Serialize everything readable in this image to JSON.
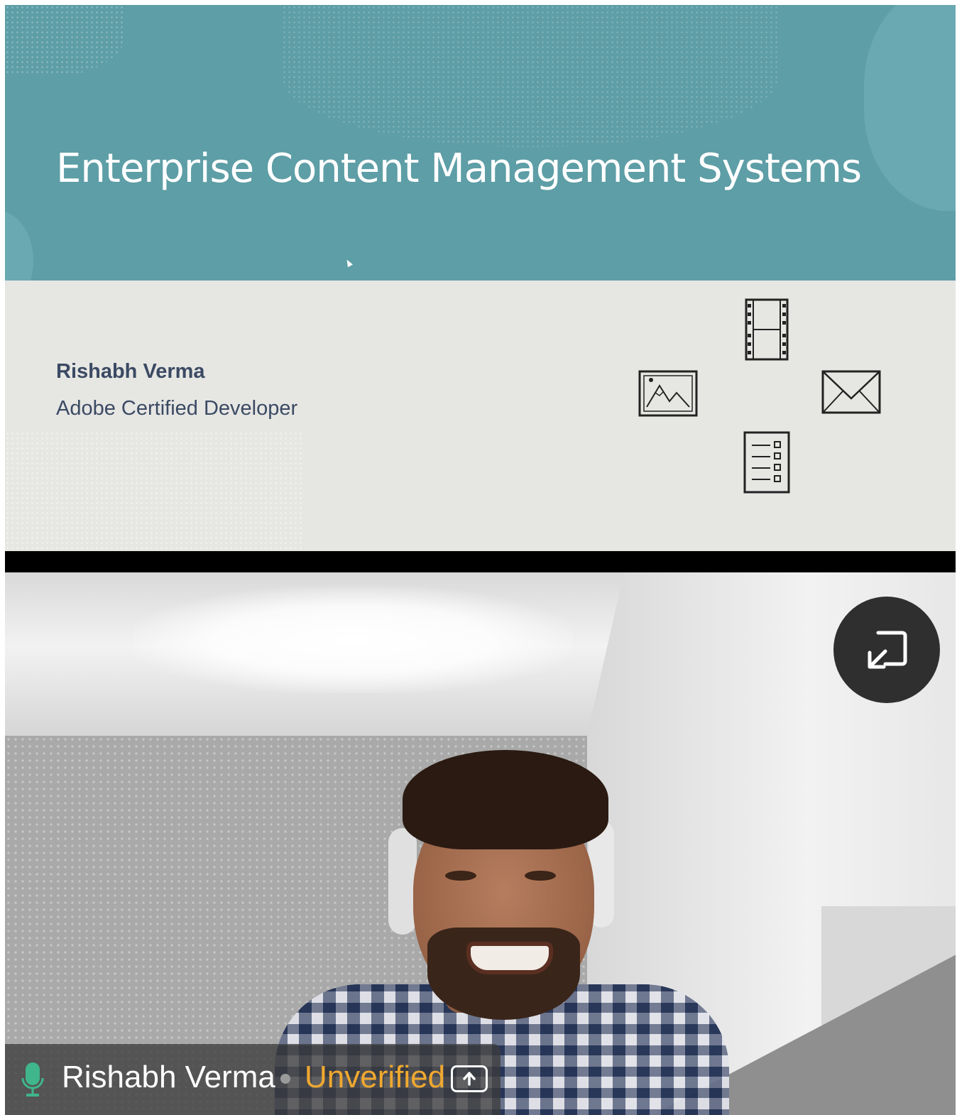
{
  "slide": {
    "title": "Enterprise Content Management Systems",
    "presenter_name": "Rishabh Verma",
    "presenter_role": "Adobe Certified Developer",
    "icons": [
      "film-icon",
      "image-icon",
      "mail-icon",
      "document-list-icon"
    ],
    "colors": {
      "header": "#5e9ea6",
      "body": "#e6e6e3",
      "text": "#3b4a63"
    }
  },
  "video_tile": {
    "participant_name": "Rishabh Verma",
    "status": "Unverified",
    "mic_icon": "microphone-icon",
    "exit_fullscreen_icon": "exit-fullscreen-icon",
    "share_icon": "upload-arrow-icon",
    "colors": {
      "status": "#f0a830",
      "mic": "#3fb68b"
    }
  }
}
